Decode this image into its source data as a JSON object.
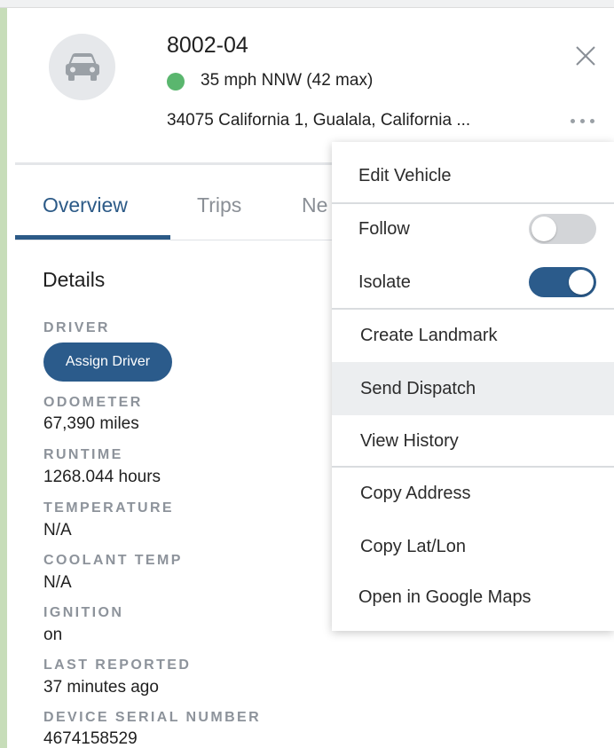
{
  "vehicle": {
    "name": "8002-04",
    "speed": "35 mph NNW (42 max)",
    "address": "34075 California 1, Gualala, California ...",
    "status_color": "#5ab66e"
  },
  "tabs": [
    {
      "label": "Overview",
      "active": true
    },
    {
      "label": "Trips",
      "active": false
    },
    {
      "label": "Ne",
      "active": false
    }
  ],
  "details": {
    "heading": "Details",
    "driver_label": "DRIVER",
    "assign_driver_label": "Assign Driver",
    "fields": [
      {
        "label": "ODOMETER",
        "value": "67,390 miles"
      },
      {
        "label": "RUNTIME",
        "value": "1268.044 hours"
      },
      {
        "label": "TEMPERATURE",
        "value": "N/A"
      },
      {
        "label": "COOLANT TEMP",
        "value": "N/A"
      },
      {
        "label": "IGNITION",
        "value": "on"
      },
      {
        "label": "LAST REPORTED",
        "value": "37 minutes ago"
      },
      {
        "label": "DEVICE SERIAL NUMBER",
        "value": "4674158529"
      }
    ]
  },
  "menu": {
    "edit_vehicle": "Edit Vehicle",
    "follow": {
      "label": "Follow",
      "enabled": false
    },
    "isolate": {
      "label": "Isolate",
      "enabled": true
    },
    "create_landmark": "Create Landmark",
    "send_dispatch": "Send Dispatch",
    "view_history": "View History",
    "copy_address": "Copy Address",
    "copy_latlon": "Copy Lat/Lon",
    "open_google_maps": "Open in Google Maps"
  },
  "icons": {
    "avatar": "car-icon",
    "close": "close-icon",
    "more": "more-options-icon"
  },
  "colors": {
    "accent": "#2b5b8b",
    "status_green": "#5ab66e"
  }
}
